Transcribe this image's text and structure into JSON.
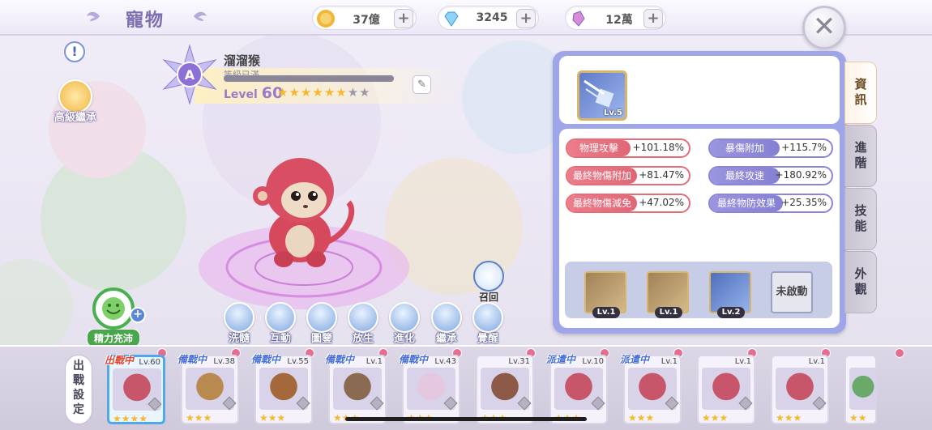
{
  "header": {
    "title": "寵物",
    "resources": [
      {
        "name": "gold",
        "icon": "coin-icon",
        "value": "37億"
      },
      {
        "name": "diamond",
        "icon": "diamond-icon",
        "value": "3245"
      },
      {
        "name": "crystal",
        "icon": "crystal-icon",
        "value": "12萬"
      }
    ]
  },
  "left": {
    "advanced_inherit": "高級繼承",
    "energy": "精力充沛",
    "recall": "召回"
  },
  "pet": {
    "name": "溜溜猴",
    "sub": "等級已滿",
    "level_prefix": "Level",
    "level": "60",
    "rank": "A",
    "stars_filled": 6,
    "stars_total": 8
  },
  "actions": [
    {
      "label": "洗髓",
      "icon": "bubble-icon"
    },
    {
      "label": "互動",
      "icon": "heart-icon"
    },
    {
      "label": "圖鑒",
      "icon": "book-icon"
    },
    {
      "label": "放生",
      "icon": "fish-icon"
    },
    {
      "label": "進化",
      "icon": "crystal-icon"
    },
    {
      "label": "繼承",
      "icon": "dna-icon"
    },
    {
      "label": "覺醒",
      "icon": "gear-icon"
    }
  ],
  "panel": {
    "skill_level": "Lv.5",
    "stats": [
      {
        "name": "物理攻擊",
        "value": "+101.18%",
        "color": "red"
      },
      {
        "name": "暴傷附加",
        "value": "+115.7%",
        "color": "pur"
      },
      {
        "name": "最終物傷附加",
        "value": "+81.47%",
        "color": "red"
      },
      {
        "name": "最終攻速",
        "value": "+180.92%",
        "color": "pur"
      },
      {
        "name": "最終物傷減免",
        "value": "+47.02%",
        "color": "red"
      },
      {
        "name": "最終物防效果",
        "value": "+25.35%",
        "color": "pur"
      }
    ],
    "skills": [
      {
        "lv": "Lv.1"
      },
      {
        "lv": "Lv.1"
      },
      {
        "lv": "Lv.2"
      }
    ],
    "locked": "未啟動"
  },
  "tabs": [
    "資訊",
    "進階",
    "技能",
    "外觀"
  ],
  "bottom": {
    "deploy": "出戰設定",
    "cards": [
      {
        "lv": "Lv.60",
        "tag": "出戰中",
        "tagtype": "out",
        "stars": 4,
        "color": "#c8566a"
      },
      {
        "lv": "Lv.38",
        "tag": "備戰中",
        "tagtype": "dep",
        "stars": 3,
        "color": "#b88a4f"
      },
      {
        "lv": "Lv.55",
        "tag": "備戰中",
        "tagtype": "dep",
        "stars": 3,
        "color": "#a5683a"
      },
      {
        "lv": "Lv.1",
        "tag": "備戰中",
        "tagtype": "dep",
        "stars": 3,
        "color": "#8a6a50"
      },
      {
        "lv": "Lv.43",
        "tag": "備戰中",
        "tagtype": "dep",
        "stars": 3,
        "color": "#e4c8e0"
      },
      {
        "lv": "Lv.31",
        "tag": "",
        "tagtype": "",
        "stars": 3,
        "color": "#8c5a46"
      },
      {
        "lv": "Lv.10",
        "tag": "派遣中",
        "tagtype": "dep",
        "stars": 3,
        "color": "#c8566a"
      },
      {
        "lv": "Lv.1",
        "tag": "派遣中",
        "tagtype": "dep",
        "stars": 3,
        "color": "#c8566a"
      },
      {
        "lv": "Lv.1",
        "tag": "",
        "tagtype": "",
        "stars": 3,
        "color": "#c8566a"
      },
      {
        "lv": "Lv.1",
        "tag": "",
        "tagtype": "",
        "stars": 3,
        "color": "#c8566a"
      },
      {
        "lv": "",
        "tag": "",
        "tagtype": "",
        "stars": 2,
        "color": "#6aa96a"
      }
    ]
  }
}
